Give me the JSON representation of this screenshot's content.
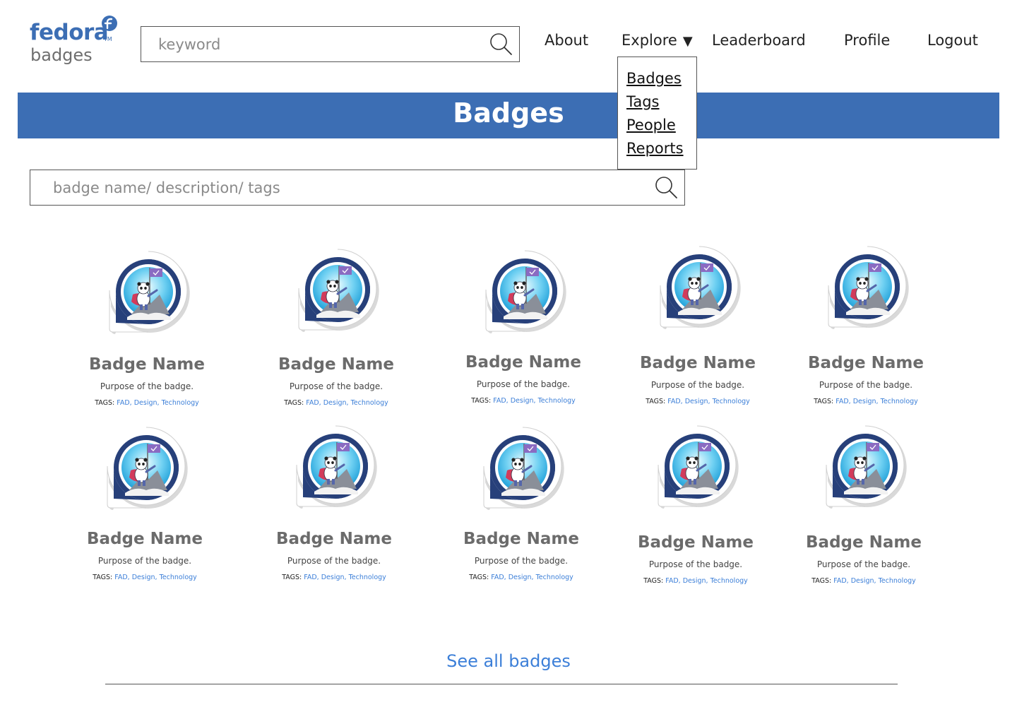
{
  "logo": {
    "brand": "fedora",
    "trademark": "TM",
    "product": "badges"
  },
  "header": {
    "search_placeholder": "keyword",
    "nav": {
      "about": "About",
      "explore": "Explore",
      "leaderboard": "Leaderboard",
      "profile": "Profile",
      "logout": "Logout"
    },
    "explore_menu": [
      "Badges",
      "Tags",
      "People",
      "Reports"
    ]
  },
  "banner": {
    "title": "Badges"
  },
  "badge_search": {
    "placeholder": "badge name/ description/ tags"
  },
  "badges": [
    {
      "name": "Badge Name",
      "purpose": "Purpose of the badge.",
      "tags_label": "TAGS:",
      "tags": [
        "FAD",
        "Design",
        "Technology"
      ]
    },
    {
      "name": "Badge Name",
      "purpose": "Purpose of the badge.",
      "tags_label": "TAGS:",
      "tags": [
        "FAD",
        "Design",
        "Technology"
      ]
    },
    {
      "name": "Badge Name",
      "purpose": "Purpose of the badge.",
      "tags_label": "TAGS:",
      "tags": [
        "FAD",
        "Design",
        "Technology"
      ]
    },
    {
      "name": "Badge Name",
      "purpose": "Purpose of the badge.",
      "tags_label": "TAGS:",
      "tags": [
        "FAD",
        "Design",
        "Technology"
      ]
    },
    {
      "name": "Badge Name",
      "purpose": "Purpose of the badge.",
      "tags_label": "TAGS:",
      "tags": [
        "FAD",
        "Design",
        "Technology"
      ]
    },
    {
      "name": "Badge Name",
      "purpose": "Purpose of the badge.",
      "tags_label": "TAGS:",
      "tags": [
        "FAD",
        "Design",
        "Technology"
      ]
    },
    {
      "name": "Badge Name",
      "purpose": "Purpose of the badge.",
      "tags_label": "TAGS:",
      "tags": [
        "FAD",
        "Design",
        "Technology"
      ]
    },
    {
      "name": "Badge Name",
      "purpose": "Purpose of the badge.",
      "tags_label": "TAGS:",
      "tags": [
        "FAD",
        "Design",
        "Technology"
      ]
    },
    {
      "name": "Badge Name",
      "purpose": "Purpose of the badge.",
      "tags_label": "TAGS:",
      "tags": [
        "FAD",
        "Design",
        "Technology"
      ]
    },
    {
      "name": "Badge Name",
      "purpose": "Purpose of the badge.",
      "tags_label": "TAGS:",
      "tags": [
        "FAD",
        "Design",
        "Technology"
      ]
    }
  ],
  "footer": {
    "see_all": "See all badges"
  },
  "colors": {
    "brand_blue": "#3c6eb4",
    "link_blue": "#3c7fd8",
    "badge_name_gray": "#6b6b6b"
  }
}
